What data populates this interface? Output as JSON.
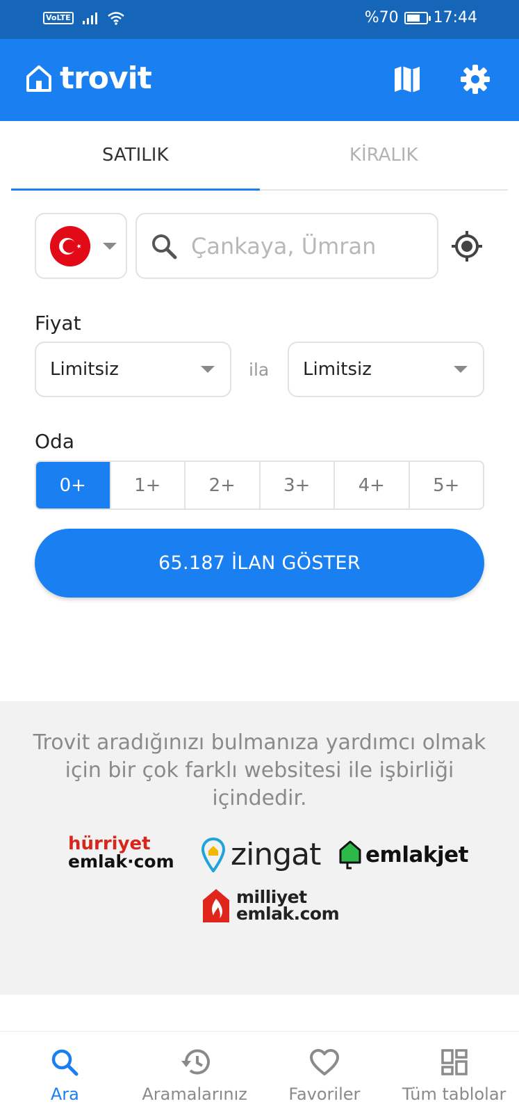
{
  "status_bar": {
    "network_badge": "VoLTE",
    "battery": "%70",
    "battery_level": 0.7,
    "time": "17:44"
  },
  "header": {
    "logo_text": "trovit",
    "icons": [
      "home-outline-icon",
      "map-icon",
      "gear-icon"
    ],
    "brand_color": "#1a7ff0"
  },
  "tabs": [
    {
      "label": "SATILIK",
      "active": true
    },
    {
      "label": "KİRALIK",
      "active": false
    }
  ],
  "search": {
    "country": "Türkiye flag",
    "placeholder": "Çankaya, Ümran",
    "value": ""
  },
  "price": {
    "label": "Fiyat",
    "min": "Limitsiz",
    "separator": "ila",
    "max": "Limitsiz"
  },
  "rooms": {
    "label": "Oda",
    "options": [
      "0+",
      "1+",
      "2+",
      "3+",
      "4+",
      "5+"
    ],
    "selected": "0+"
  },
  "show_button": "65.187 İLAN GÖSTER",
  "partners": {
    "text": "Trovit aradığınızı bulmanıza yardımcı olmak için bir çok farklı websitesi ile işbirliği içindedir.",
    "hurriyet": {
      "line1": "hürriyet",
      "line2": "emlak·com"
    },
    "zingat": "zingat",
    "emlakjet": "emlakjet",
    "milliyet": {
      "line1": "milliyet",
      "line2": "emlak.com"
    }
  },
  "bottom_nav": [
    {
      "label": "Ara",
      "icon": "search-icon",
      "active": true
    },
    {
      "label": "Aramalarınız",
      "icon": "history-icon",
      "active": false
    },
    {
      "label": "Favoriler",
      "icon": "heart-icon",
      "active": false
    },
    {
      "label": "Tüm tablolar",
      "icon": "dashboard-icon",
      "active": false
    }
  ]
}
